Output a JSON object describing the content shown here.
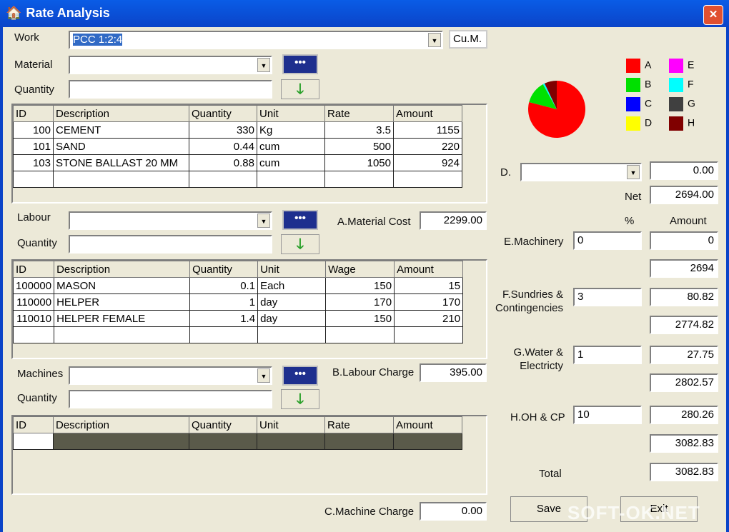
{
  "window": {
    "title": "Rate Analysis",
    "close": "✕"
  },
  "work": {
    "label": "Work",
    "value": "PCC 1:2:4",
    "unit": "Cu.M."
  },
  "material": {
    "label": "Material",
    "quantity_label": "Quantity",
    "more": "•••",
    "add": "🡓",
    "headers": [
      "ID",
      "Description",
      "Quantity",
      "Unit",
      "Rate",
      "Amount"
    ],
    "rows": [
      [
        "100",
        "CEMENT",
        "330",
        "Kg",
        "3.5",
        "1155"
      ],
      [
        "101",
        "SAND",
        "0.44",
        "cum",
        "500",
        "220"
      ],
      [
        "103",
        "STONE BALLAST 20 MM",
        "0.88",
        "cum",
        "1050",
        "924"
      ]
    ],
    "cost_label": "A.Material Cost",
    "cost": "2299.00"
  },
  "labour": {
    "label": "Labour",
    "quantity_label": "Quantity",
    "more": "•••",
    "add": "🡓",
    "headers": [
      "ID",
      "Description",
      "Quantity",
      "Unit",
      "Wage",
      "Amount"
    ],
    "rows": [
      [
        "100000",
        "MASON",
        "0.1",
        "Each",
        "150",
        "15"
      ],
      [
        "110000",
        "HELPER",
        "1",
        "day",
        "170",
        "170"
      ],
      [
        "110010",
        "HELPER FEMALE",
        "1.4",
        "day",
        "150",
        "210"
      ]
    ],
    "cost_label": "B.Labour Charge",
    "cost": "395.00"
  },
  "machines": {
    "label": "Machines",
    "quantity_label": "Quantity",
    "more": "•••",
    "add": "🡓",
    "headers": [
      "ID",
      "Description",
      "Quantity",
      "Unit",
      "Rate",
      "Amount"
    ],
    "cost_label": "C.Machine Charge",
    "cost": "0.00"
  },
  "chart_data": {
    "type": "pie",
    "legend": [
      "A",
      "B",
      "C",
      "D",
      "E",
      "F",
      "G",
      "H"
    ],
    "colors": [
      "#ff0000",
      "#00e000",
      "#0000ff",
      "#ffff00",
      "#ff00ff",
      "#00ffff",
      "#404040",
      "#800000"
    ],
    "values": [
      79,
      13,
      0,
      0,
      0,
      1,
      0,
      7
    ],
    "legend_placement": "right"
  },
  "summary": {
    "d_label": "D.",
    "d_value": "0.00",
    "net_label": "Net",
    "net": "2694.00",
    "pct_header": "%",
    "amount_header": "Amount",
    "e_label": "E.Machinery",
    "e_pct": "0",
    "e_amt": "0",
    "e_sub": "2694",
    "f_label1": "F.Sundries &",
    "f_label2": "Contingencies",
    "f_pct": "3",
    "f_amt": "80.82",
    "f_sub": "2774.82",
    "g_label1": "G.Water &",
    "g_label2": "Electricty",
    "g_pct": "1",
    "g_amt": "27.75",
    "g_sub": "2802.57",
    "h_label": "H.OH & CP",
    "h_pct": "10",
    "h_amt": "280.26",
    "h_sub": "3082.83",
    "total_label": "Total",
    "total": "3082.83"
  },
  "buttons": {
    "save": "Save",
    "exit": "Exit"
  },
  "watermark": "SOFT-OK.NET"
}
